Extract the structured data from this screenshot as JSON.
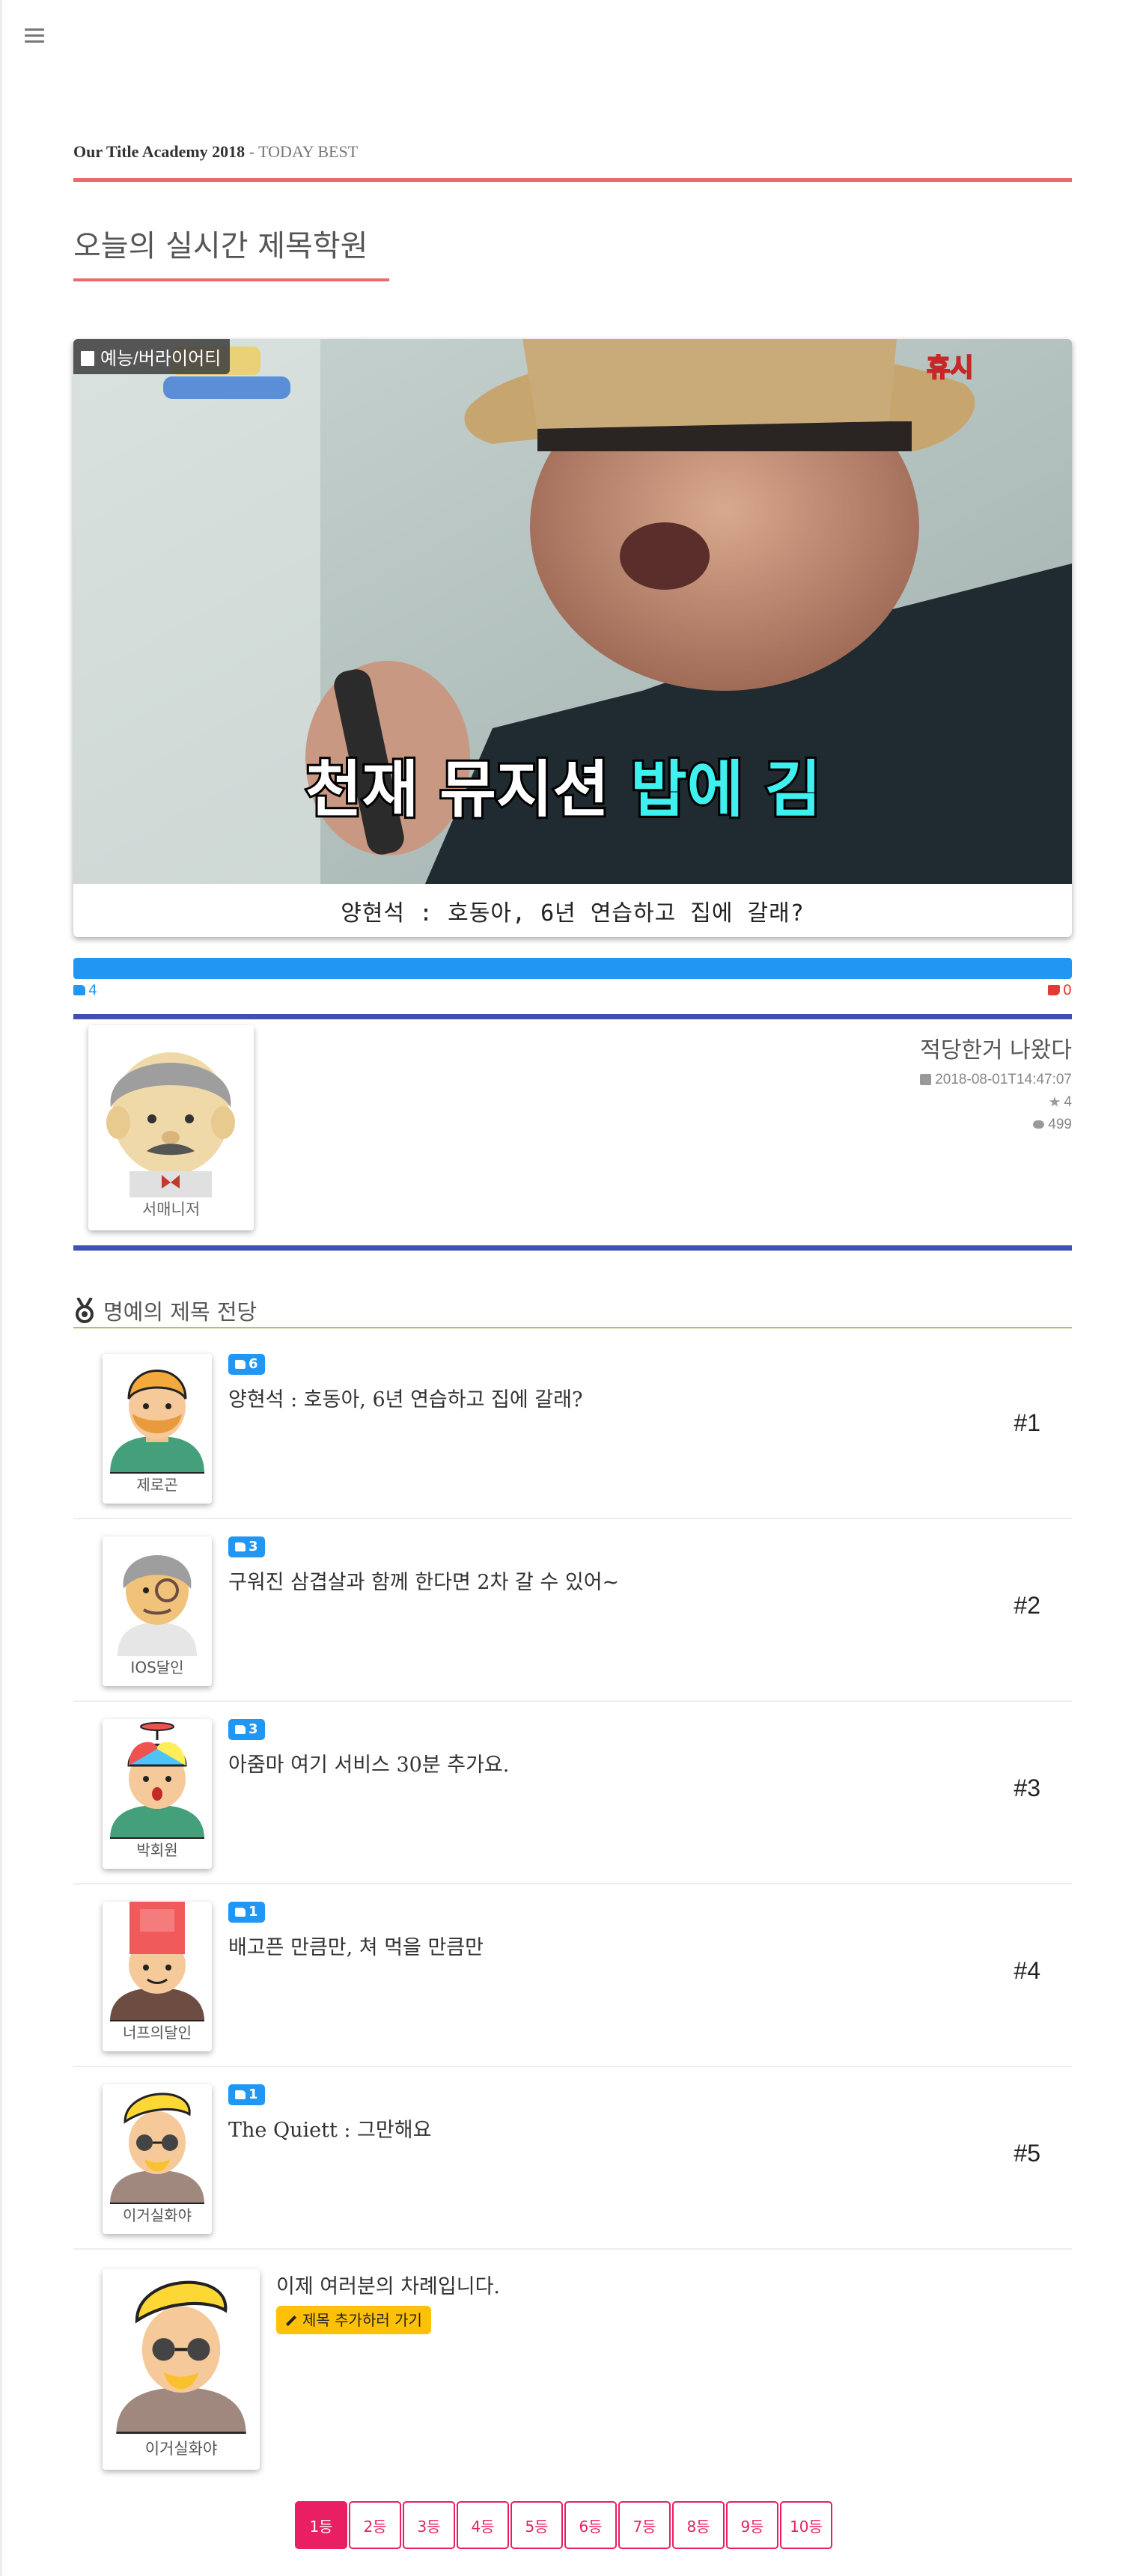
{
  "breadcrumb": {
    "site": "Our Title Academy 2018",
    "separator": " - ",
    "section": "TODAY BEST"
  },
  "page_title": "오늘의 실시간 제목학원",
  "feature": {
    "category": "예능/버라이어티",
    "image_subtitle_white": "천재 뮤지션 ",
    "image_subtitle_cyan": "밥에 김",
    "image_watermark": "휴시",
    "title": "양현석 : 호동아, 6년 연습하고 집에 갈래?",
    "likes": "4",
    "dislikes": "0",
    "like_ratio": 1.0
  },
  "comment": {
    "author": "서매니저",
    "text": "적당한거 나왔다",
    "date": "2018-08-01T14:47:07",
    "stars": "4",
    "views": "499"
  },
  "hall_of_fame": {
    "title": "명예의 제목 전당",
    "entries": [
      {
        "name": "제로곤",
        "likes": "6",
        "title": "양현석 : 호동아, 6년 연습하고 집에 갈래?",
        "rank": "#1"
      },
      {
        "name": "IOS달인",
        "likes": "3",
        "title": "구워진 삼겹살과 함께 한다면 2차 갈 수 있어~",
        "rank": "#2"
      },
      {
        "name": "박회원",
        "likes": "3",
        "title": "아줌마 여기 서비스 30분 추가요.",
        "rank": "#3"
      },
      {
        "name": "너프의달인",
        "likes": "1",
        "title": "배고픈 만큼만, 쳐 먹을 만큼만",
        "rank": "#4"
      },
      {
        "name": "이거실화야",
        "likes": "1",
        "title": "The Quiett : 그만해요",
        "rank": "#5"
      }
    ]
  },
  "cta": {
    "name": "이거실화야",
    "message": "이제 여러분의 차례입니다.",
    "button": "제목 추가하러 가기"
  },
  "pagination": [
    "1등",
    "2등",
    "3등",
    "4등",
    "5등",
    "6등",
    "7등",
    "8등",
    "9등",
    "10등"
  ],
  "active_page": "1등",
  "colors": {
    "accent_red": "#ec6a6a",
    "indigo": "#3f51b5",
    "like_blue": "#2196f3",
    "pink": "#e91e63",
    "amber": "#ffc107",
    "green_rule": "#9ccc65"
  }
}
